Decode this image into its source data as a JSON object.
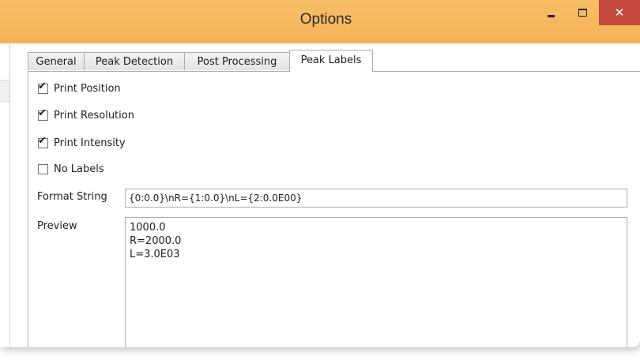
{
  "window": {
    "title": "Options",
    "controls": {
      "close_glyph": "✕"
    },
    "accent": "#f5b257",
    "close_color": "#c5483e"
  },
  "tabs": [
    {
      "label": "General",
      "selected": false
    },
    {
      "label": "Peak Detection",
      "selected": false
    },
    {
      "label": "Post Processing",
      "selected": false
    },
    {
      "label": "Peak Labels",
      "selected": true
    }
  ],
  "checkboxes": [
    {
      "label": "Print Position",
      "checked": true
    },
    {
      "label": "Print Resolution",
      "checked": true
    },
    {
      "label": "Print Intensity",
      "checked": true
    },
    {
      "label": "No Labels",
      "checked": false
    }
  ],
  "format": {
    "label": "Format String",
    "value": "{0:0.0}\\nR={1:0.0}\\nL={2:0.0E00}"
  },
  "preview": {
    "label": "Preview",
    "lines": [
      "1000.0",
      "R=2000.0",
      "L=3.0E03"
    ]
  }
}
